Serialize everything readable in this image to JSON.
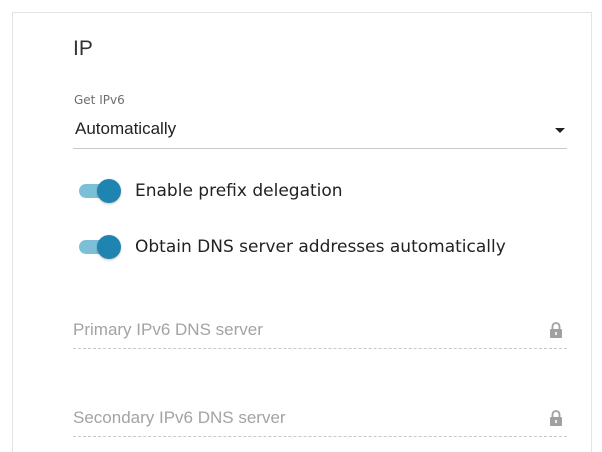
{
  "section": {
    "title": "IP"
  },
  "get_ipv6": {
    "label": "Get IPv6",
    "value": "Automatically",
    "caret_icon": "caret-down-icon"
  },
  "toggles": [
    {
      "label": "Enable prefix delegation",
      "enabled": true
    },
    {
      "label": "Obtain DNS server addresses automatically",
      "enabled": true
    }
  ],
  "inputs": [
    {
      "placeholder": "Primary IPv6 DNS server",
      "value": "",
      "locked": true,
      "icon": "lock-icon"
    },
    {
      "placeholder": "Secondary IPv6 DNS server",
      "value": "",
      "locked": true,
      "icon": "lock-icon"
    }
  ],
  "colors": {
    "toggle_knob": "#1f84b0",
    "toggle_track": "#7cc0d8",
    "lock_icon": "#a0a0a0"
  }
}
